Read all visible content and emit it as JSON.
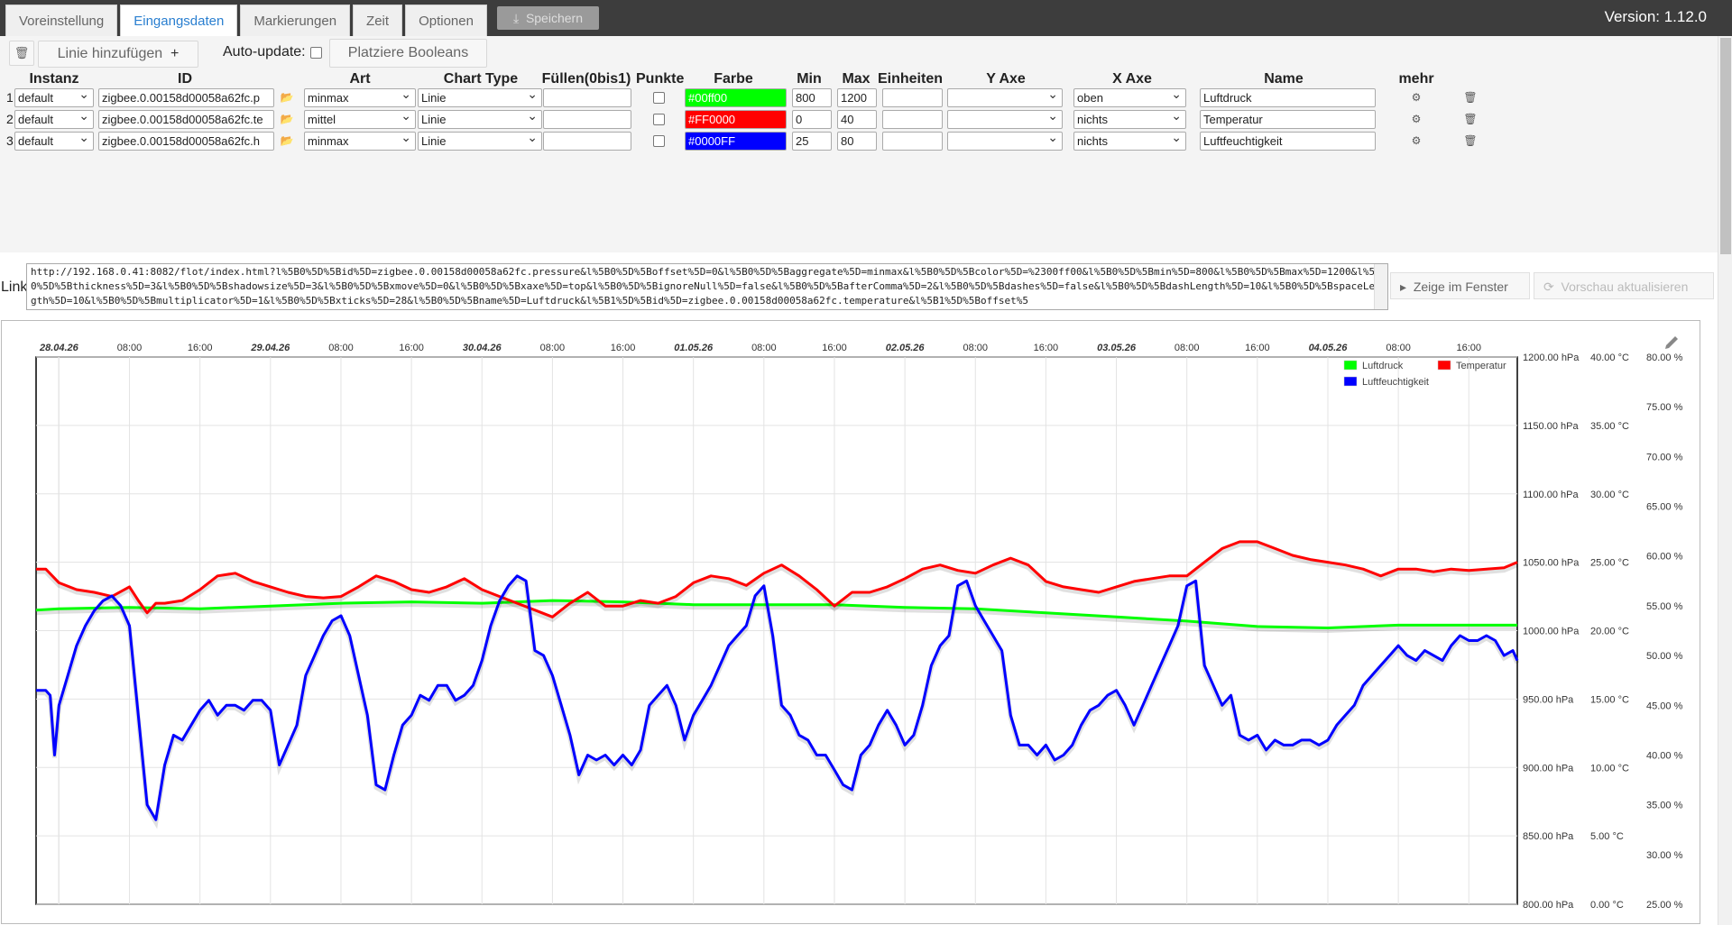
{
  "tabs": [
    {
      "label": "Voreinstellung",
      "active": false
    },
    {
      "label": "Eingangsdaten",
      "active": true
    },
    {
      "label": "Markierungen",
      "active": false
    },
    {
      "label": "Zeit",
      "active": false
    },
    {
      "label": "Optionen",
      "active": false
    }
  ],
  "save_label": "Speichern",
  "version": "Version: 1.12.0",
  "toolbar": {
    "add_line_label": "Linie hinzufügen",
    "autoupdate_label": "Auto-update:",
    "autoupdate_checked": false,
    "booleans_label": "Platziere Booleans"
  },
  "headers": {
    "instanz": "Instanz",
    "id": "ID",
    "art": "Art",
    "chart_type": "Chart Type",
    "fuellen": "Füllen(0bis1)",
    "punkte": "Punkte",
    "farbe": "Farbe",
    "min": "Min",
    "max": "Max",
    "einheiten": "Einheiten",
    "yaxe": "Y Axe",
    "xaxe": "X Axe",
    "name": "Name",
    "mehr": "mehr"
  },
  "rows": [
    {
      "num": "1",
      "instanz": "default",
      "id": "zigbee.0.00158d00058a62fc.p",
      "art": "minmax",
      "chart_type": "Linie",
      "fill": "",
      "points": false,
      "color_text": "#00ff00",
      "color": "#00ff00",
      "min": "800",
      "max": "1200",
      "units": "",
      "yaxe": "",
      "xaxe": "oben",
      "name": "Luftdruck"
    },
    {
      "num": "2",
      "instanz": "default",
      "id": "zigbee.0.00158d00058a62fc.te",
      "art": "mittel",
      "chart_type": "Linie",
      "fill": "",
      "points": false,
      "color_text": "#FF0000",
      "color": "#ff0000",
      "min": "0",
      "max": "40",
      "units": "",
      "yaxe": "",
      "xaxe": "nichts",
      "name": "Temperatur"
    },
    {
      "num": "3",
      "instanz": "default",
      "id": "zigbee.0.00158d00058a62fc.h",
      "art": "minmax",
      "chart_type": "Linie",
      "fill": "",
      "points": false,
      "color_text": "#0000FF",
      "color": "#0000ff",
      "min": "25",
      "max": "80",
      "units": "",
      "yaxe": "",
      "xaxe": "nichts",
      "name": "Luftfeuchtigkeit"
    }
  ],
  "link": {
    "label": "Link",
    "url": "http://192.168.0.41:8082/flot/index.html?l%5B0%5D%5Bid%5D=zigbee.0.00158d00058a62fc.pressure&l%5B0%5D%5Boffset%5D=0&l%5B0%5D%5Baggregate%5D=minmax&l%5B0%5D%5Bcolor%5D=%2300ff00&l%5B0%5D%5Bmin%5D=800&l%5B0%5D%5Bmax%5D=1200&l%5B0%5D%5Bthickness%5D=3&l%5B0%5D%5Bshadowsize%5D=3&l%5B0%5D%5Bxmove%5D=0&l%5B0%5D%5Bxaxe%5D=top&l%5B0%5D%5BignoreNull%5D=false&l%5B0%5D%5BafterComma%5D=2&l%5B0%5D%5Bdashes%5D=false&l%5B0%5D%5BdashLength%5D=10&l%5B0%5D%5BspaceLength%5D=10&l%5B0%5D%5Bmultiplicator%5D=1&l%5B0%5D%5Bxticks%5D=28&l%5B0%5D%5Bname%5D=Luftdruck&l%5B1%5D%5Bid%5D=zigbee.0.00158d00058a62fc.temperature&l%5B1%5D%5Boffset%5",
    "show_window_label": "Zeige im Fenster",
    "refresh_label": "Vorschau aktualisieren"
  },
  "chart_data": {
    "type": "line",
    "x_tick_labels": [
      "28.04.26",
      "08:00",
      "16:00",
      "29.04.26",
      "08:00",
      "16:00",
      "30.04.26",
      "08:00",
      "16:00",
      "01.05.26",
      "08:00",
      "16:00",
      "02.05.26",
      "08:00",
      "16:00",
      "03.05.26",
      "08:00",
      "16:00",
      "04.05.26",
      "08:00",
      "16:00"
    ],
    "x_tick_bold": [
      true,
      false,
      false,
      true,
      false,
      false,
      true,
      false,
      false,
      true,
      false,
      false,
      true,
      false,
      false,
      true,
      false,
      false,
      true,
      false,
      false
    ],
    "x_hours": [
      0,
      8,
      16,
      24,
      32,
      40,
      48,
      56,
      64,
      72,
      80,
      88,
      96,
      104,
      112,
      120,
      128,
      136,
      144,
      152,
      160
    ],
    "x_range_hours": [
      -2.6,
      165.5
    ],
    "axes": [
      {
        "series": "Luftdruck",
        "unit": "hPa",
        "min": 800,
        "max": 1200,
        "tick_labels": [
          "1200.00 hPa",
          "1150.00 hPa",
          "1100.00 hPa",
          "1050.00 hPa",
          "1000.00 hPa",
          "950.00 hPa",
          "900.00 hPa",
          "850.00 hPa",
          "800.00 hPa"
        ]
      },
      {
        "series": "Temperatur",
        "unit": "°C",
        "min": 0,
        "max": 40,
        "tick_labels": [
          "40.00 °C",
          "35.00 °C",
          "30.00 °C",
          "25.00 °C",
          "20.00 °C",
          "15.00 °C",
          "10.00 °C",
          "5.00 °C",
          "0.00 °C"
        ]
      },
      {
        "series": "Luftfeuchtigkeit",
        "unit": "%",
        "min": 25,
        "max": 80,
        "tick_labels": [
          "80.00 %",
          "75.00 %",
          "70.00 %",
          "65.00 %",
          "60.00 %",
          "55.00 %",
          "50.00 %",
          "45.00 %",
          "40.00 %",
          "35.00 %",
          "30.00 %",
          "25.00 %"
        ]
      }
    ],
    "grid": true,
    "legend_position": "top-right",
    "series": [
      {
        "name": "Luftdruck",
        "color": "#00ff00",
        "axis": 0,
        "x": [
          -2.6,
          0,
          8,
          16,
          24,
          32,
          40,
          48,
          56,
          64,
          72,
          80,
          88,
          96,
          104,
          112,
          120,
          128,
          136,
          144,
          152,
          160,
          165.5
        ],
        "y": [
          1015,
          1016,
          1017,
          1016,
          1018,
          1020,
          1021,
          1020,
          1022,
          1021,
          1019,
          1019,
          1019,
          1017,
          1016,
          1013,
          1010,
          1007,
          1003,
          1002,
          1004,
          1004,
          1004
        ]
      },
      {
        "name": "Temperatur",
        "color": "#ff0000",
        "axis": 1,
        "x": [
          -2.6,
          -1.5,
          0,
          2,
          4,
          6,
          8,
          9,
          10,
          11,
          12,
          14,
          16,
          18,
          20,
          22,
          24,
          26,
          28,
          30,
          32,
          34,
          36,
          38,
          40,
          42,
          44,
          46,
          48,
          50,
          52,
          54,
          56,
          58,
          60,
          62,
          64,
          66,
          68,
          70,
          72,
          74,
          76,
          78,
          80,
          82,
          84,
          86,
          88,
          90,
          92,
          94,
          96,
          98,
          100,
          102,
          104,
          106,
          108,
          110,
          112,
          114,
          116,
          118,
          120,
          122,
          124,
          126,
          128,
          130,
          132,
          134,
          136,
          138,
          140,
          142,
          144,
          146,
          148,
          150,
          152,
          154,
          156,
          158,
          160,
          162,
          164,
          165.5
        ],
        "y": [
          24.5,
          24.5,
          23.5,
          23.0,
          22.8,
          22.5,
          23.2,
          22.2,
          21.3,
          22.0,
          22.0,
          22.2,
          23.0,
          24.0,
          24.2,
          23.6,
          23.2,
          22.8,
          22.5,
          22.4,
          22.5,
          23.2,
          24.0,
          23.6,
          23.0,
          22.8,
          23.2,
          23.8,
          23.0,
          22.5,
          22.0,
          21.5,
          21.0,
          22.0,
          22.8,
          21.8,
          21.8,
          22.2,
          22.0,
          22.5,
          23.5,
          24.0,
          23.8,
          23.3,
          24.2,
          24.8,
          24.0,
          23.0,
          21.8,
          22.8,
          22.8,
          23.2,
          23.8,
          24.5,
          24.8,
          24.4,
          24.2,
          24.8,
          25.3,
          24.8,
          23.6,
          23.2,
          23.0,
          22.8,
          23.2,
          23.6,
          23.8,
          24.0,
          24.0,
          25.0,
          26.0,
          26.5,
          26.5,
          26.0,
          25.5,
          25.2,
          25.0,
          24.8,
          24.5,
          24.0,
          24.5,
          24.5,
          24.3,
          24.5,
          24.4,
          24.5,
          24.6,
          25.0
        ]
      },
      {
        "name": "Luftfeuchtigkeit",
        "color": "#0000ff",
        "axis": 2,
        "x": [
          -2.6,
          -1.5,
          -1,
          -0.5,
          0,
          1,
          2,
          3,
          4,
          5,
          6,
          7,
          8,
          9,
          10,
          11,
          12,
          13,
          14,
          15,
          16,
          17,
          18,
          19,
          20,
          21,
          22,
          23,
          24,
          25,
          26,
          27,
          28,
          29,
          30,
          31,
          32,
          33,
          34,
          35,
          36,
          37,
          38,
          39,
          40,
          41,
          42,
          43,
          44,
          45,
          46,
          47,
          48,
          49,
          50,
          51,
          52,
          53,
          54,
          55,
          56,
          57,
          58,
          59,
          60,
          61,
          62,
          63,
          64,
          65,
          66,
          67,
          68,
          69,
          70,
          71,
          72,
          73,
          74,
          75,
          76,
          77,
          78,
          79,
          80,
          81,
          82,
          83,
          84,
          85,
          86,
          87,
          88,
          89,
          90,
          91,
          92,
          93,
          94,
          95,
          96,
          97,
          98,
          99,
          100,
          101,
          102,
          103,
          104,
          105,
          106,
          107,
          108,
          109,
          110,
          111,
          112,
          113,
          114,
          115,
          116,
          117,
          118,
          119,
          120,
          121,
          122,
          123,
          124,
          125,
          126,
          127,
          128,
          129,
          130,
          131,
          132,
          133,
          134,
          135,
          136,
          137,
          138,
          139,
          140,
          141,
          142,
          143,
          144,
          145,
          146,
          147,
          148,
          149,
          150,
          151,
          152,
          153,
          154,
          155,
          156,
          157,
          158,
          159,
          160,
          161,
          162,
          163,
          164,
          165,
          165.5
        ],
        "y": [
          46.5,
          46.5,
          46,
          40,
          45,
          48,
          51,
          53,
          54.5,
          55.5,
          56,
          55,
          53,
          44,
          35,
          33.5,
          39,
          42,
          41.5,
          43,
          44.5,
          45.5,
          44,
          45,
          45,
          44.5,
          45.5,
          45.5,
          44.5,
          39,
          41,
          43,
          48,
          50,
          52,
          53.5,
          54,
          52,
          48,
          44,
          37,
          36.5,
          40,
          43,
          44,
          46,
          45.5,
          47,
          47,
          45.5,
          46,
          47,
          49.5,
          53,
          55.5,
          57,
          58,
          57.5,
          50.5,
          50,
          48,
          45,
          42,
          38,
          40,
          39.5,
          40,
          39,
          40,
          39,
          40.5,
          45,
          46,
          47,
          45,
          41.5,
          44,
          45.5,
          47,
          49,
          51,
          52,
          53,
          56,
          57,
          52,
          45,
          44,
          42,
          41.5,
          40,
          40,
          38.5,
          37,
          36.5,
          40,
          41,
          43,
          44.5,
          43,
          41,
          42,
          45,
          49,
          51,
          52,
          57,
          57.5,
          55,
          53.5,
          52,
          50.5,
          44,
          41,
          41,
          40,
          41,
          39.5,
          40,
          41,
          43,
          44.5,
          45,
          46,
          46.5,
          45,
          43,
          45,
          47,
          49,
          51,
          53,
          57,
          57.5,
          49,
          47,
          45,
          46,
          42,
          41.5,
          42,
          40.5,
          41.5,
          41,
          41,
          41.5,
          41.5,
          41,
          41.5,
          43,
          44,
          45,
          47,
          48,
          49,
          50,
          51,
          50,
          49.5,
          50.5,
          50,
          49.5,
          51,
          52,
          51.5,
          51.5,
          52,
          51.5,
          50,
          50.5,
          49.5
        ]
      }
    ]
  }
}
